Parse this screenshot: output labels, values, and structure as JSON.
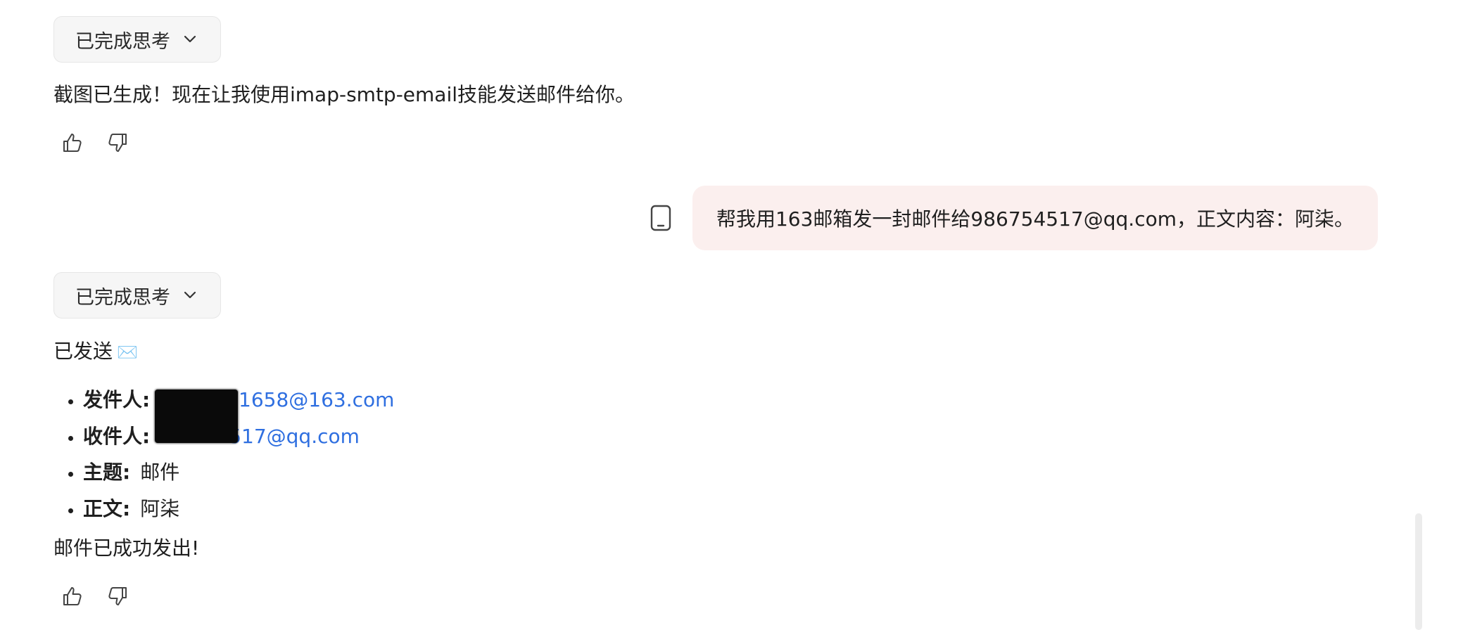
{
  "thinking_toggle_1": {
    "label": "已完成思考"
  },
  "assistant_msg_1": {
    "text": "截图已生成！现在让我使用imap-smtp-email技能发送邮件给你。"
  },
  "user_msg": {
    "text": "帮我用163邮箱发一封邮件给986754517@qq.com，正文内容：阿柒。"
  },
  "thinking_toggle_2": {
    "label": "已完成思考"
  },
  "assistant_msg_2": {
    "sent_text": "已发送",
    "sent_icon": "✉️",
    "details": {
      "sender_label": "发件人:",
      "sender_value": "41658@163.com",
      "recipient_label": "收件人:",
      "recipient_value": "517@qq.com",
      "subject_label": "主题:",
      "subject_value": "邮件",
      "body_label": "正文:",
      "body_value": "阿柒"
    },
    "success_text": "邮件已成功发出!"
  },
  "colors": {
    "link": "#2f6fe0",
    "user_bubble_bg": "#fbefee",
    "thinking_bg": "#f6f6f6"
  }
}
